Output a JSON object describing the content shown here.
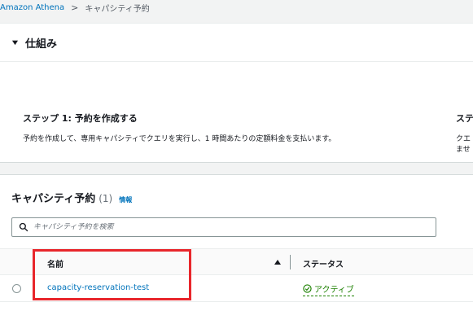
{
  "breadcrumb": {
    "root": "Amazon Athena",
    "separator": ">",
    "current": "キャパシティ予約"
  },
  "how_it_works": {
    "title": "仕組み",
    "steps": [
      {
        "title": "ステップ 1: 予約を作成する",
        "description": "予約を作成して、専用キャパシティでクエリを実行し、1 時間あたりの定額料金を支払います。"
      },
      {
        "title": "ステ",
        "description_line1": "クエ",
        "description_line2": "ませ"
      }
    ]
  },
  "reservations": {
    "title": "キャパシティ予約",
    "count": "(1)",
    "info_link": "情報",
    "search": {
      "value": "",
      "placeholder": "キャパシティ予約を検索"
    },
    "columns": {
      "name": "名前",
      "status": "ステータス"
    },
    "rows": [
      {
        "name": "capacity-reservation-test",
        "status": "アクティブ"
      }
    ]
  },
  "icons": {
    "expand": "caret-down-icon",
    "search": "search-icon",
    "sort": "sort-ascending-icon",
    "status": "check-circle-icon"
  },
  "colors": {
    "link": "#0073bb",
    "success": "#1d8102",
    "highlight": "#e8262b"
  }
}
